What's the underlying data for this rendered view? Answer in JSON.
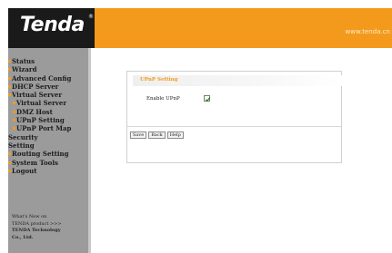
{
  "header": {
    "logo": "Tenda",
    "logo_mark": "®",
    "url": "www.tenda.cn"
  },
  "sidebar": {
    "items": [
      {
        "label": "Status",
        "level": 1
      },
      {
        "label": "Wizard",
        "level": 1
      },
      {
        "label": "Advanced Config",
        "level": 1
      },
      {
        "label": "DHCP Server",
        "level": 1
      },
      {
        "label": "Virtual Server",
        "level": 1
      },
      {
        "label": "Virtual Server",
        "level": 2
      },
      {
        "label": "DMZ Host",
        "level": 2
      },
      {
        "label": "UPnP Setting",
        "level": 2
      },
      {
        "label": "UPnP Port Map",
        "level": 2
      },
      {
        "label": "Security Setting",
        "level": 1
      },
      {
        "label": "Routing Setting",
        "level": 1
      },
      {
        "label": "System Tools",
        "level": 1
      },
      {
        "label": "Logout",
        "level": 1
      }
    ],
    "footer": {
      "line1": "What's New on",
      "line2": "TENDA product >>>",
      "line3": "TENDA Technology",
      "line4": "Co., Ltd."
    }
  },
  "main": {
    "panel_title": "UPnP Setting",
    "enable_label": "Enable UPnP",
    "enable_checked": true,
    "buttons": {
      "save": "Save",
      "back": "Back",
      "help": "Help"
    }
  },
  "colors": {
    "accent": "#f39a1c",
    "logo_bg": "#1a1a1a",
    "sidebar_bg": "#9b9b9b"
  }
}
